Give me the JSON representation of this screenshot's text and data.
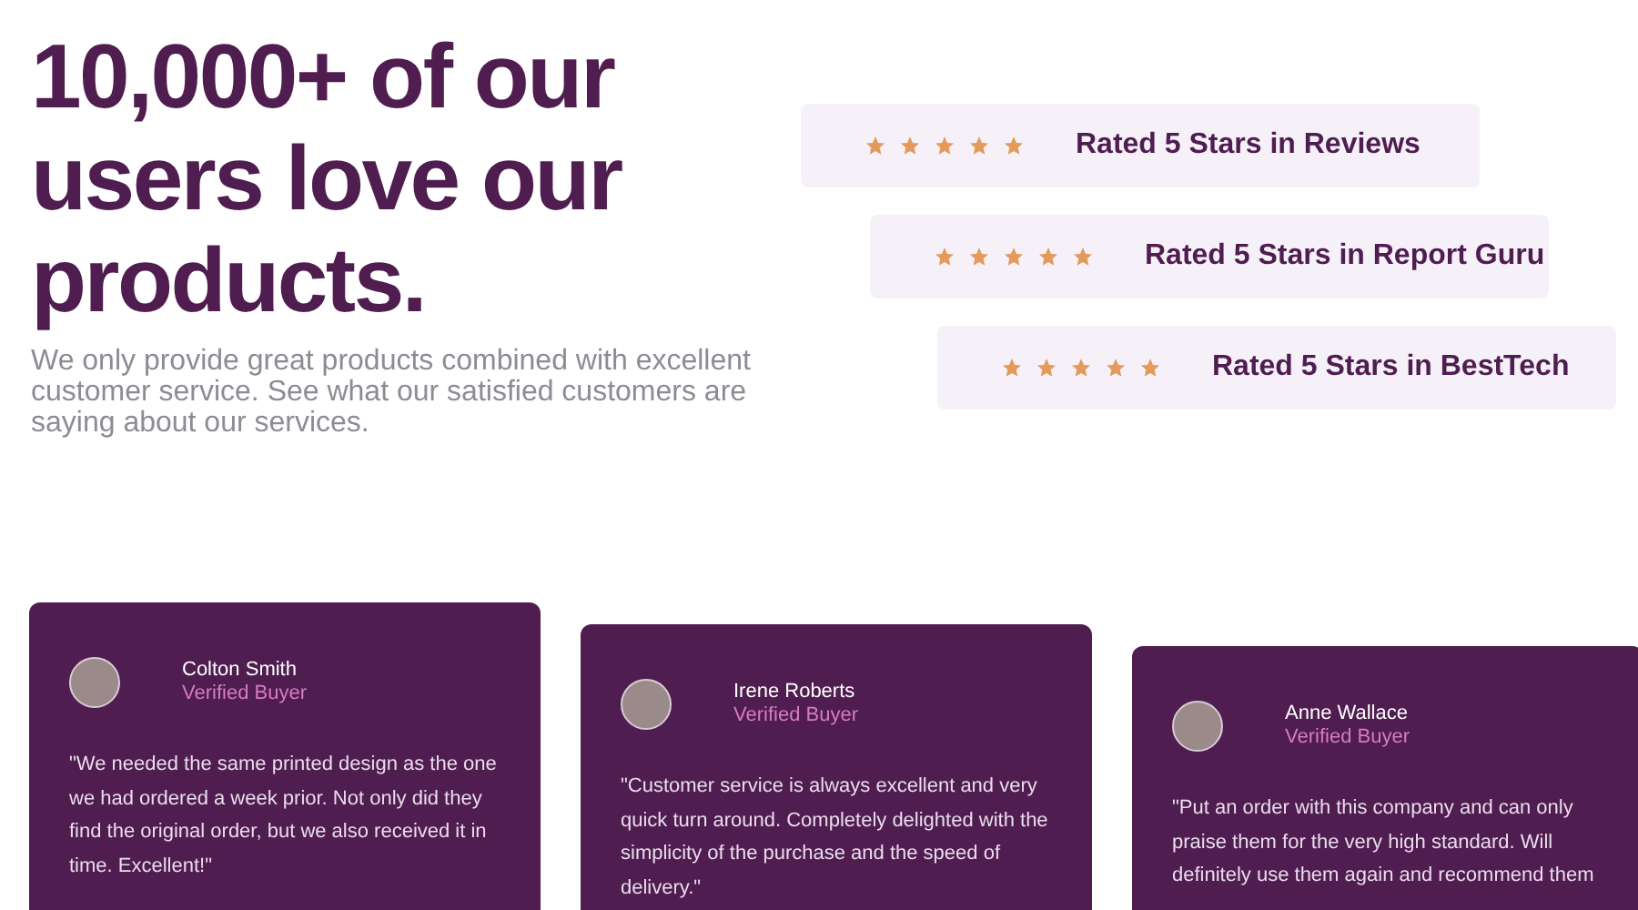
{
  "heading": "10,000+ of our users love our products.",
  "intro": "We only provide great products combined with excellent customer service. See what our satisfied customers are saying about our services.",
  "ratings": [
    {
      "stars": 5,
      "label": "Rated 5 Stars in Reviews"
    },
    {
      "stars": 5,
      "label": "Rated 5 Stars in Report Guru"
    },
    {
      "stars": 5,
      "label": "Rated 5 Stars in BestTech"
    }
  ],
  "testimonials": [
    {
      "name": "Colton Smith",
      "badge": "Verified Buyer",
      "quote": "\"We needed the same printed design as the one we had ordered a week prior. Not only did they find the original order, but we also received it in time. Excellent!\""
    },
    {
      "name": "Irene Roberts",
      "badge": "Verified Buyer",
      "quote": "\"Customer service is always excellent and very quick turn around. Completely delighted with the simplicity of the purchase and the speed of delivery.\""
    },
    {
      "name": "Anne Wallace",
      "badge": "Verified Buyer",
      "quote": "\"Put an order with this company and can only praise them for the very high standard. Will definitely use them again and recommend them"
    }
  ]
}
